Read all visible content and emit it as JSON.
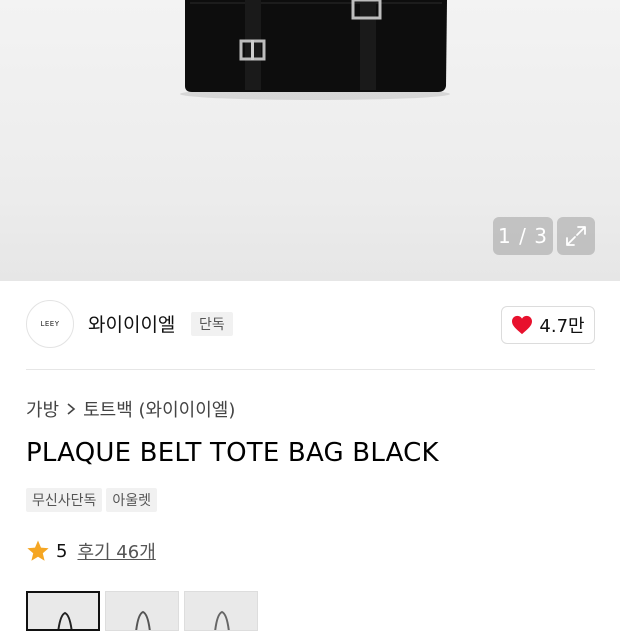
{
  "gallery": {
    "counter": "1 / 3",
    "expand_icon": "expand-icon"
  },
  "store": {
    "logo_text": "LEEY",
    "name": "와이이이엘",
    "exclusive_badge": "단독",
    "likes": "4.7만",
    "like_color": "#e8112d"
  },
  "breadcrumb": {
    "category": "가방",
    "subcategory": "토트백 (와이이이엘)"
  },
  "product": {
    "title": "PLAQUE BELT TOTE BAG BLACK",
    "tags": [
      "무신사단독",
      "아울렛"
    ],
    "rating": "5",
    "reviews": "후기 46개",
    "star_color": "#f5a623"
  },
  "thumbnails": [
    {
      "label": "thumbnail-1",
      "active": true
    },
    {
      "label": "thumbnail-2",
      "active": false
    },
    {
      "label": "thumbnail-3",
      "active": false
    }
  ]
}
